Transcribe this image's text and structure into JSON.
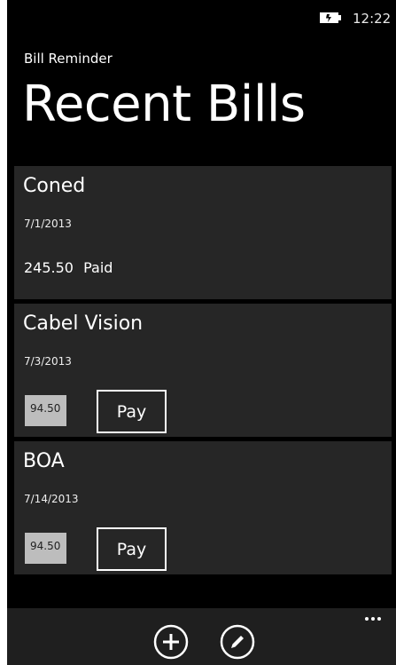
{
  "status_bar": {
    "battery_icon": "battery-charging-icon",
    "time": "12:22"
  },
  "header": {
    "app_name": "Bill Reminder",
    "title": "Recent Bills"
  },
  "bills": [
    {
      "name": "Coned",
      "date": "7/1/2013",
      "amount": "245.50",
      "status": "Paid"
    },
    {
      "name": "Cabel Vision",
      "date": "7/3/2013",
      "amount": "94.50",
      "pay_label": "Pay"
    },
    {
      "name": "BOA",
      "date": "7/14/2013",
      "amount": "94.50",
      "pay_label": "Pay"
    }
  ],
  "app_bar": {
    "add_icon": "add-circle-icon",
    "edit_icon": "edit-pencil-icon",
    "more_label": "..."
  },
  "colors": {
    "background": "#000000",
    "card": "#262626",
    "amount_box": "#bdbdbd",
    "app_bar": "#1f1f1f",
    "text": "#ffffff"
  }
}
